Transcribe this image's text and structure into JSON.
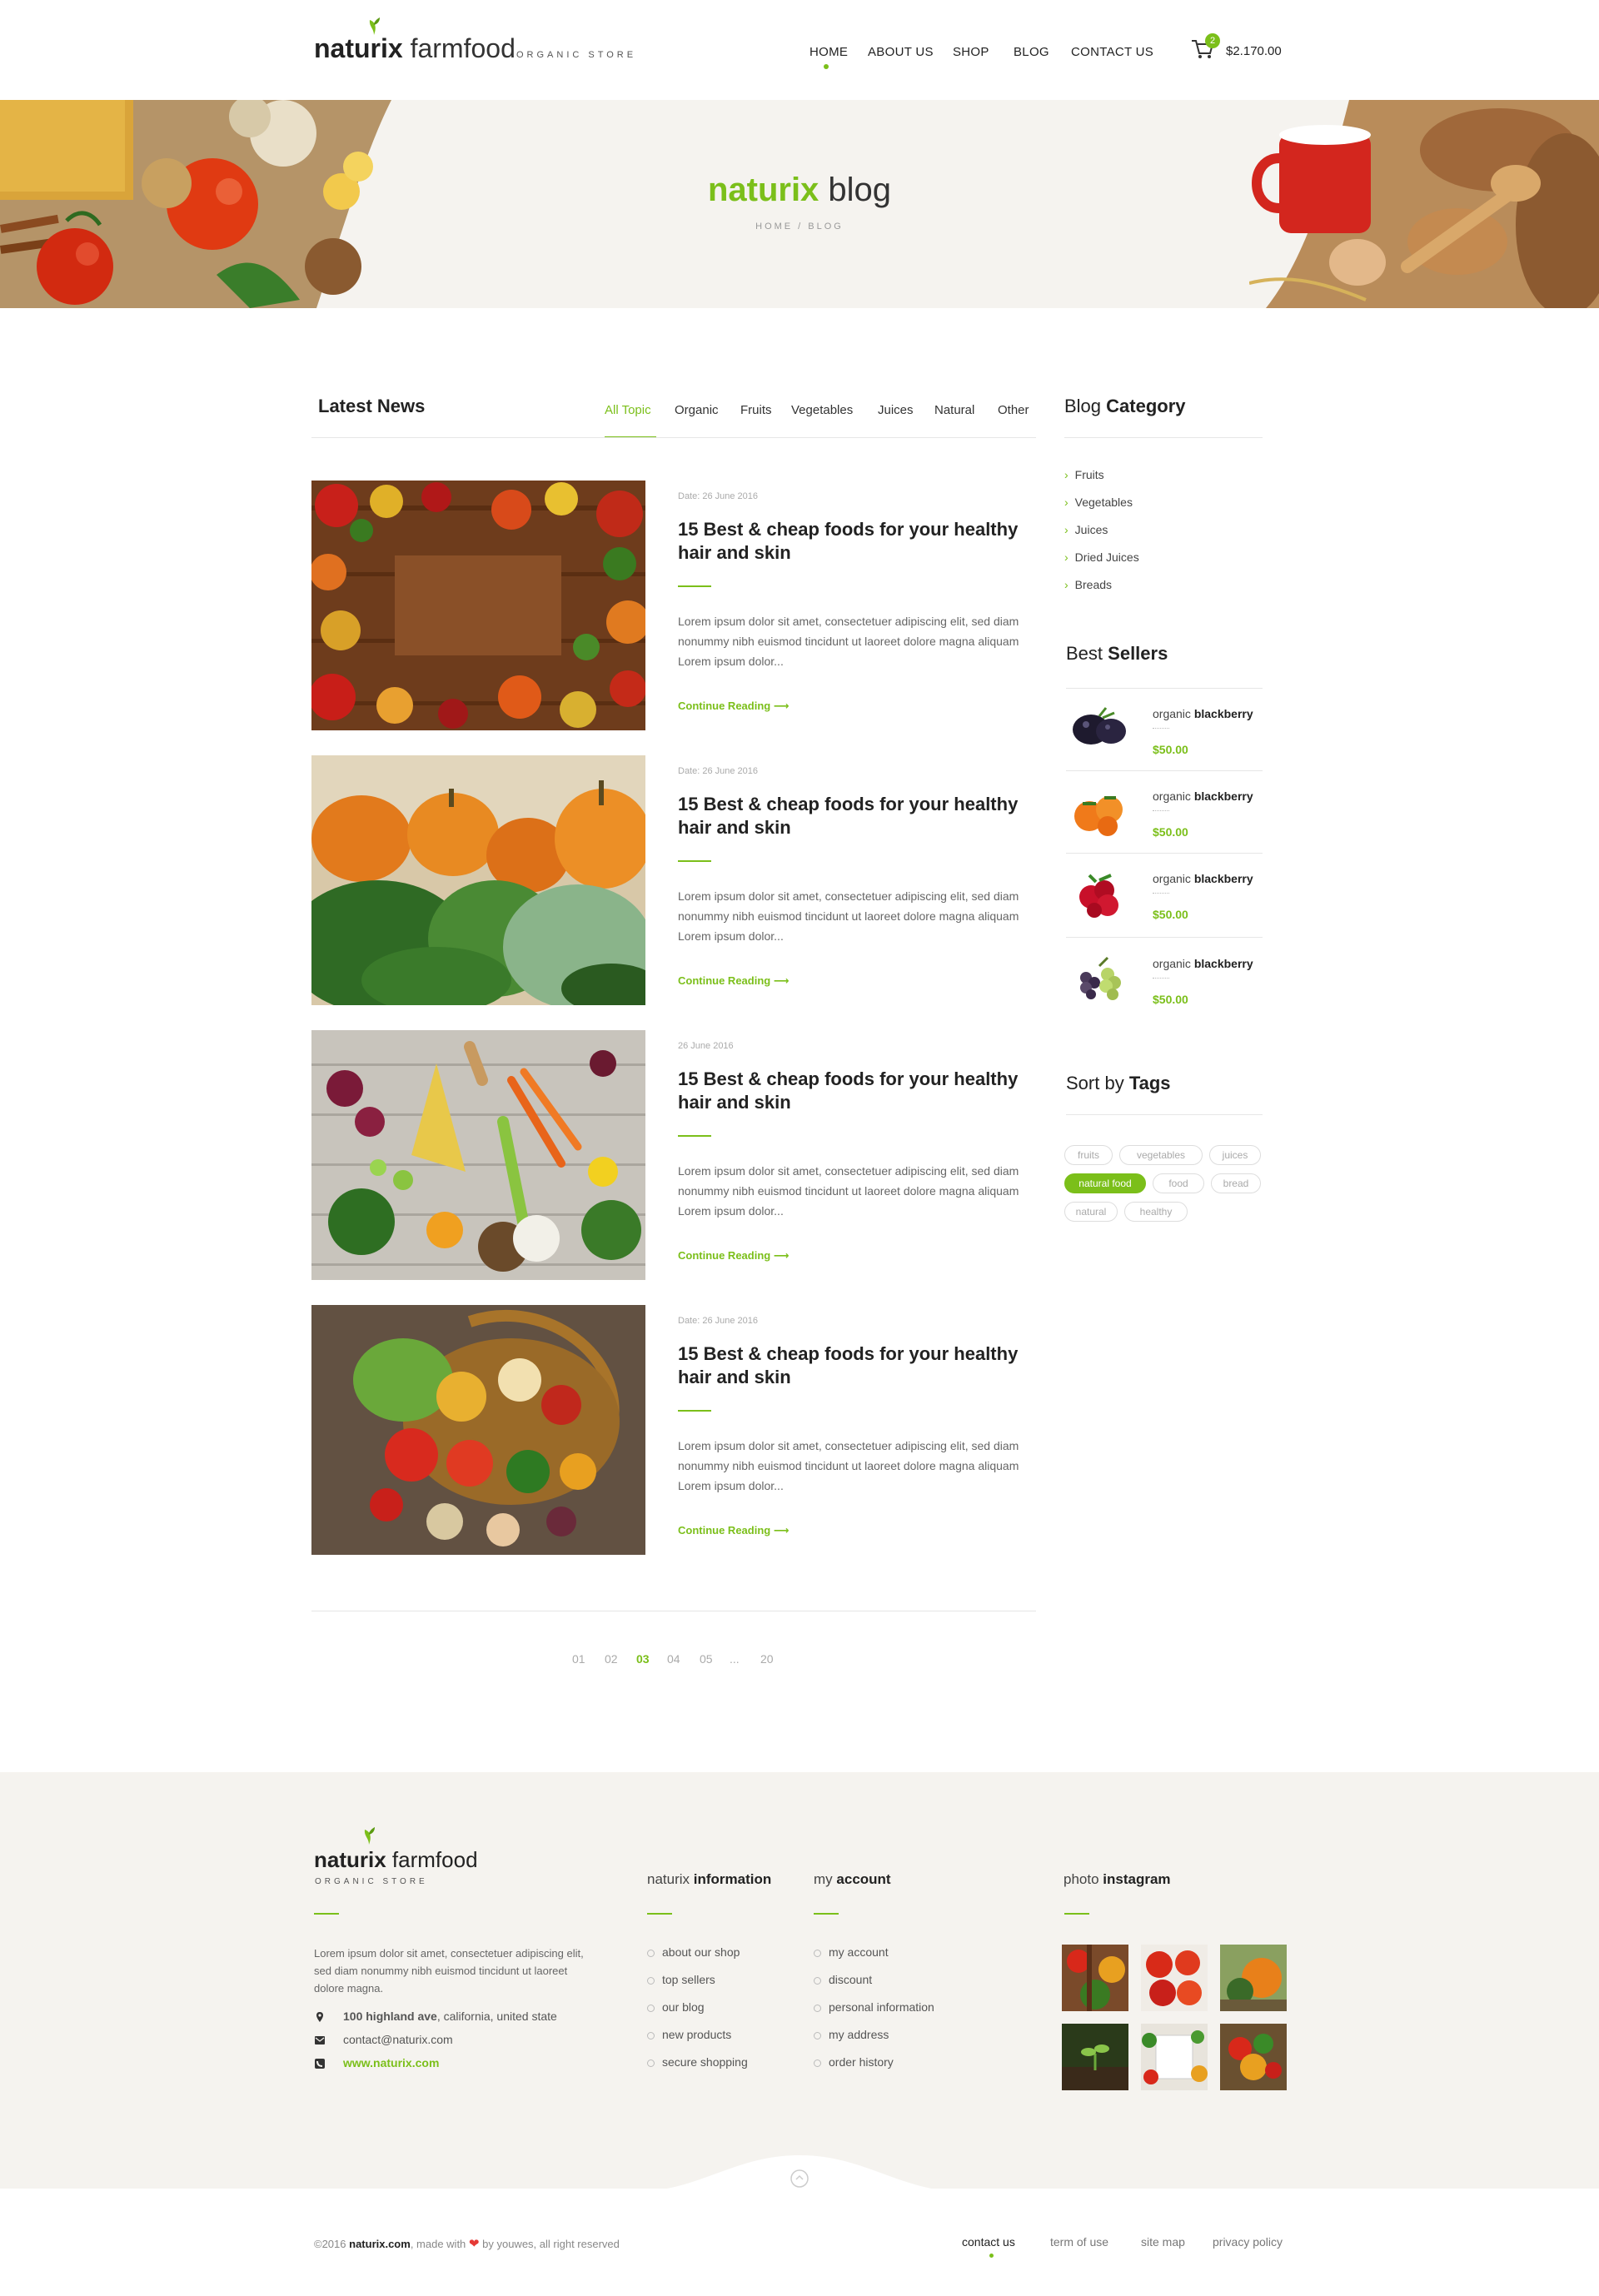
{
  "header": {
    "logo_bold": "naturix",
    "logo_light": "farmfood",
    "logo_tagline": "ORGANIC STORE",
    "nav": [
      "HOME",
      "ABOUT US",
      "SHOP",
      "BLOG",
      "CONTACT US"
    ],
    "active_nav": "HOME",
    "cart_count": "2",
    "cart_total": "$2.170.00"
  },
  "hero": {
    "title_bold": "naturix",
    "title_light": "blog",
    "breadcrumb": "HOME / BLOG"
  },
  "main": {
    "title": "Latest News",
    "filters": [
      "All Topic",
      "Organic",
      "Fruits",
      "Vegetables",
      "Juices",
      "Natural",
      "Other"
    ],
    "active_filter": "All Topic",
    "posts": [
      {
        "date": "Date: 26 June 2016",
        "title": "15 Best & cheap foods for your healthy hair and skin",
        "excerpt": "Lorem ipsum dolor sit amet, consectetuer adipiscing elit, sed diam nonummy nibh euismod tincidunt ut laoreet dolore magna aliquam Lorem ipsum dolor...",
        "more": "Continue Reading",
        "image": "autumn-fruits-frame"
      },
      {
        "date": "Date: 26 June 2016",
        "title": "15 Best & cheap foods for your healthy hair and skin",
        "excerpt": "Lorem ipsum dolor sit amet, consectetuer adipiscing elit, sed diam nonummy nibh euismod tincidunt ut laoreet dolore magna aliquam Lorem ipsum dolor...",
        "more": "Continue Reading",
        "image": "pumpkin-field"
      },
      {
        "date": "26 June 2016",
        "title": "15 Best & cheap foods for your healthy hair and skin",
        "excerpt": "Lorem ipsum dolor sit amet, consectetuer adipiscing elit, sed diam nonummy nibh euismod tincidunt ut laoreet dolore magna aliquam Lorem ipsum dolor...",
        "more": "Continue Reading",
        "image": "vegetables-on-wood"
      },
      {
        "date": "Date: 26 June 2016",
        "title": "15 Best & cheap foods for your healthy hair and skin",
        "excerpt": "Lorem ipsum dolor sit amet, consectetuer adipiscing elit, sed diam nonummy nibh euismod tincidunt ut laoreet dolore magna aliquam Lorem ipsum dolor...",
        "more": "Continue Reading",
        "image": "vegetable-basket"
      }
    ],
    "pagination": [
      "01",
      "02",
      "03",
      "04",
      "05",
      "...",
      "20"
    ],
    "active_page": "03"
  },
  "sidebar": {
    "category_title_light": "Blog",
    "category_title_bold": "Category",
    "categories": [
      "Fruits",
      "Vegetables",
      "Juices",
      "Dried Juices",
      "Breads"
    ],
    "sellers_title_light": "Best",
    "sellers_title_bold": "Sellers",
    "sellers": [
      {
        "name_light": "organic",
        "name_bold": "blackberry",
        "price": "$50.00",
        "image": "blackberries"
      },
      {
        "name_light": "organic",
        "name_bold": "blackberry",
        "price": "$50.00",
        "image": "persimmons"
      },
      {
        "name_light": "organic",
        "name_bold": "blackberry",
        "price": "$50.00",
        "image": "cranberries"
      },
      {
        "name_light": "organic",
        "name_bold": "blackberry",
        "price": "$50.00",
        "image": "grapes"
      }
    ],
    "tags_title_light": "Sort by",
    "tags_title_bold": "Tags",
    "tags": [
      "fruits",
      "vegetables",
      "juices",
      "natural food",
      "food",
      "bread",
      "natural",
      "healthy"
    ],
    "active_tag": "natural food"
  },
  "footer": {
    "logo_bold": "naturix",
    "logo_light": "farmfood",
    "logo_tagline": "ORGANIC STORE",
    "about": "Lorem ipsum dolor sit amet, consectetuer adipiscing elit, sed diam nonummy nibh euismod tincidunt ut laoreet dolore magna.",
    "address_bold": "100 highland ave",
    "address_rest": ", california, united state",
    "email": "contact@naturix.com",
    "website": "www.naturix.com",
    "info_title_light": "naturix",
    "info_title_bold": "information",
    "info_links": [
      "about our shop",
      "top sellers",
      "our blog",
      "new products",
      "secure shopping"
    ],
    "account_title_light": "my",
    "account_title_bold": "account",
    "account_links": [
      "my account",
      "discount",
      "personal information",
      "my address",
      "order history"
    ],
    "insta_title_light": "photo",
    "insta_title_bold": "instagram",
    "copyright_pre": "©2016",
    "copyright_site": "naturix.com",
    "copyright_mid": ", made with",
    "copyright_post": "by youwes, all right reserved",
    "bottom_links": [
      "contact us",
      "term of use",
      "site map",
      "privacy policy"
    ],
    "active_bottom_link": "contact us"
  },
  "colors": {
    "accent": "#7bbf1a",
    "footer_bg": "#f5f3ef",
    "hero_bg": "#f5f3ef",
    "heart": "#e53935"
  }
}
